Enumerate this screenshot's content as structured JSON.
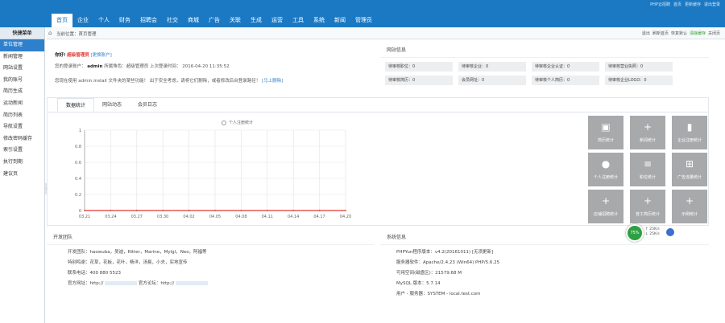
{
  "header": {
    "top_links": [
      "PHP云招聘",
      "首页",
      "更新缓存",
      "退出登录"
    ],
    "nav": [
      "首页",
      "企业",
      "个人",
      "财务",
      "招聘会",
      "社交",
      "商城",
      "广告",
      "关联",
      "生成",
      "运营",
      "工具",
      "系统",
      "新闻",
      "管理员"
    ],
    "active_nav": "首页"
  },
  "sidebar": {
    "title": "快捷菜单",
    "items": [
      "单位管理",
      "新闻管理",
      "网站设置",
      "我的账号",
      "简历生成",
      "运动新闻",
      "简历列表",
      "导航设置",
      "修改密码缓存",
      "索引设置",
      "执行到期",
      "建议页"
    ]
  },
  "breadcrumb": {
    "path": "当前位置：首页管理",
    "right": [
      "退出",
      "刷新首页",
      "恢复默认",
      "清除缓存",
      "关闭页"
    ]
  },
  "welcome": {
    "hello": "你好!",
    "role": "超级管理员",
    "role_link": "[更换账户]",
    "account_line_prefix": "您的登录账户：",
    "account": "admin",
    "account_line_mid": "所属角色：超级管理员 上次登录时间：",
    "last_login": "2016-04-20 11:35:52",
    "warning": "您现在使用 admin.install 文件夹的某些功能！ 出于安全考虑，请将它们删除，或者修改后台登录路径！",
    "warning_link": "[马上删除]"
  },
  "site_info": {
    "title": "网站信息",
    "stats": [
      "待审核职位：0",
      "待审核企业：0",
      "待审核企业认证：0",
      "待审核营业执照：0",
      "待审核简历：0",
      "会员网址：0",
      "待审核个人简历：0",
      "待审核企业LOGO：0"
    ]
  },
  "stats_tabs": {
    "tabs": [
      "数据统计",
      "网站动态",
      "会员日志"
    ],
    "active": "数据统计",
    "legend": "个人注册统计"
  },
  "chart_data": {
    "type": "line",
    "categories": [
      "03.21",
      "03.24",
      "03.27",
      "03.30",
      "04.02",
      "04.05",
      "04.08",
      "04.11",
      "04.14",
      "04.17",
      "04.20"
    ],
    "series": [
      {
        "name": "个人注册统计",
        "values": [
          0,
          0,
          0,
          0,
          0,
          0,
          0,
          0,
          0,
          0,
          0
        ]
      }
    ],
    "y_ticks": [
      "0",
      "0.2",
      "0.4",
      "0.6",
      "0.8",
      "1"
    ],
    "ylim": [
      0,
      1
    ],
    "grid": true,
    "line_color": "#e0362f"
  },
  "tiles": [
    {
      "label": "简历统计",
      "icon": "id-card-icon",
      "glyph": "▣"
    },
    {
      "label": "新闻统计",
      "icon": "plus-icon",
      "glyph": "+"
    },
    {
      "label": "企业注册统计",
      "icon": "briefcase-icon",
      "glyph": "▮"
    },
    {
      "label": "个人注册统计",
      "icon": "user-icon",
      "glyph": "●"
    },
    {
      "label": "职位统计",
      "icon": "list-icon",
      "glyph": "≡"
    },
    {
      "label": "广告流量统计",
      "icon": "cart-icon",
      "glyph": "⊞"
    },
    {
      "label": "店铺招聘统计",
      "icon": "plus-icon",
      "glyph": "+"
    },
    {
      "label": "普工简历统计",
      "icon": "plus-icon",
      "glyph": "+"
    },
    {
      "label": "示例统计",
      "icon": "plus-icon",
      "glyph": "+"
    }
  ],
  "team": {
    "title": "开发团队",
    "rows": [
      "开发团队：haowuba，吴迪，Ritter，Marine，Mylgl，Neo，阿福等",
      "特别鸣谢：花草，花板，花叶，杨洋，汤易，小夫，实地宣传",
      "联系电话：400 880 5523",
      "官方网址：http://"
    ],
    "blog_label": "官方论坛：http://"
  },
  "sys": {
    "title": "系统信息",
    "rows": [
      "PHPYun程序版本：v4.2(20161011) [无须更新]",
      "服务器软件：Apache/2.4.23 (Win64) PHP/5.6.25",
      "可用空间(磁盘区)：21579.68 M",
      "MySQL 版本：5.7.14",
      "用户 - 服务器：SYSTEM - local.test.com"
    ]
  },
  "speed": {
    "ball": "75%",
    "up": "↑ 25K/s",
    "down": "↓ 25K/s"
  }
}
